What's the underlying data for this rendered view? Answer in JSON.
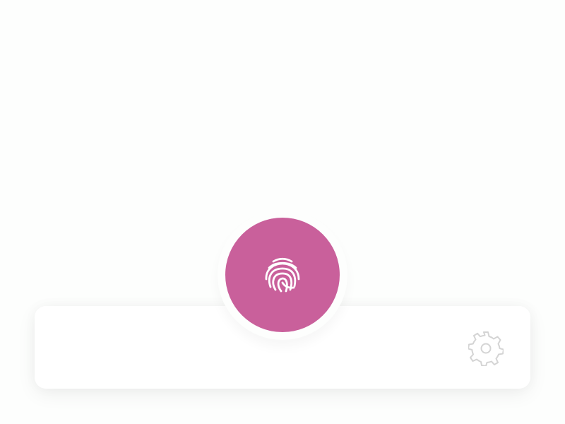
{
  "theme": {
    "background": "#fdfefd",
    "surface": "#ffffff",
    "accent": "#c9609b",
    "accent_icon": "#ffffff",
    "muted_icon": "#d4d4d4"
  },
  "fab": {
    "icon": "fingerprint-icon"
  },
  "toolbar": {
    "settings_icon": "gear-icon"
  }
}
